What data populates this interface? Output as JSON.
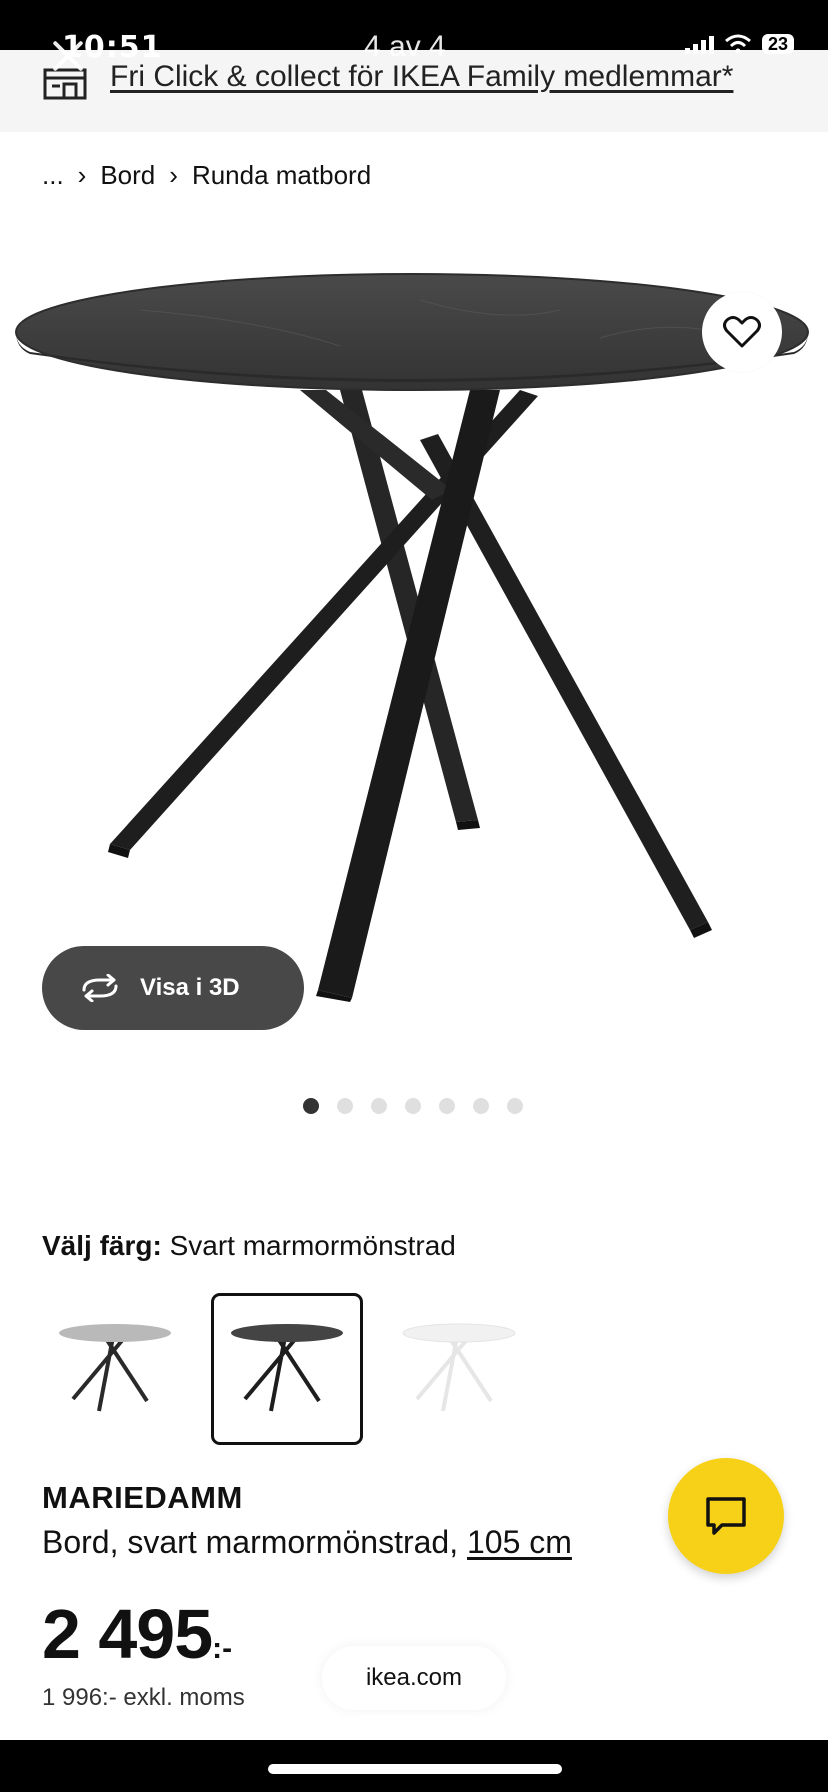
{
  "status_bar": {
    "time": "10:51",
    "battery": "23"
  },
  "promo": {
    "text": "Fri Click & collect för IKEA Family medlemmar*"
  },
  "overlay": {
    "counter": "4 av 4"
  },
  "breadcrumb": {
    "ellipsis": "...",
    "items": [
      "Bord",
      "Runda matbord"
    ]
  },
  "gallery": {
    "view3d_label": "Visa i 3D",
    "dot_count": 7,
    "active_dot": 1
  },
  "color_choice": {
    "label": "Välj färg:",
    "value": "Svart marmormönstrad",
    "swatches": [
      {
        "name": "light-grey-marble",
        "top_color": "#b9b9b9",
        "leg_color": "#2a2a2a"
      },
      {
        "name": "black-marble",
        "top_color": "#444444",
        "leg_color": "#1e1e1e",
        "selected": true
      },
      {
        "name": "white-marble",
        "top_color": "#f1f1f1",
        "leg_color": "#e6e6e6"
      }
    ]
  },
  "product": {
    "name": "MARIEDAMM",
    "description": "Bord, svart marmormönstrad,",
    "size": "105 cm",
    "price": "2 495",
    "price_suffix": ":-",
    "price_ex_vat": "1 996:- exkl. moms"
  },
  "browser": {
    "url": "ikea.com"
  },
  "colors": {
    "chat_button": "#f7d117",
    "view3d_bg": "#484848",
    "table_top": "#3f3f3f",
    "table_legs": "#1c1c1c"
  }
}
